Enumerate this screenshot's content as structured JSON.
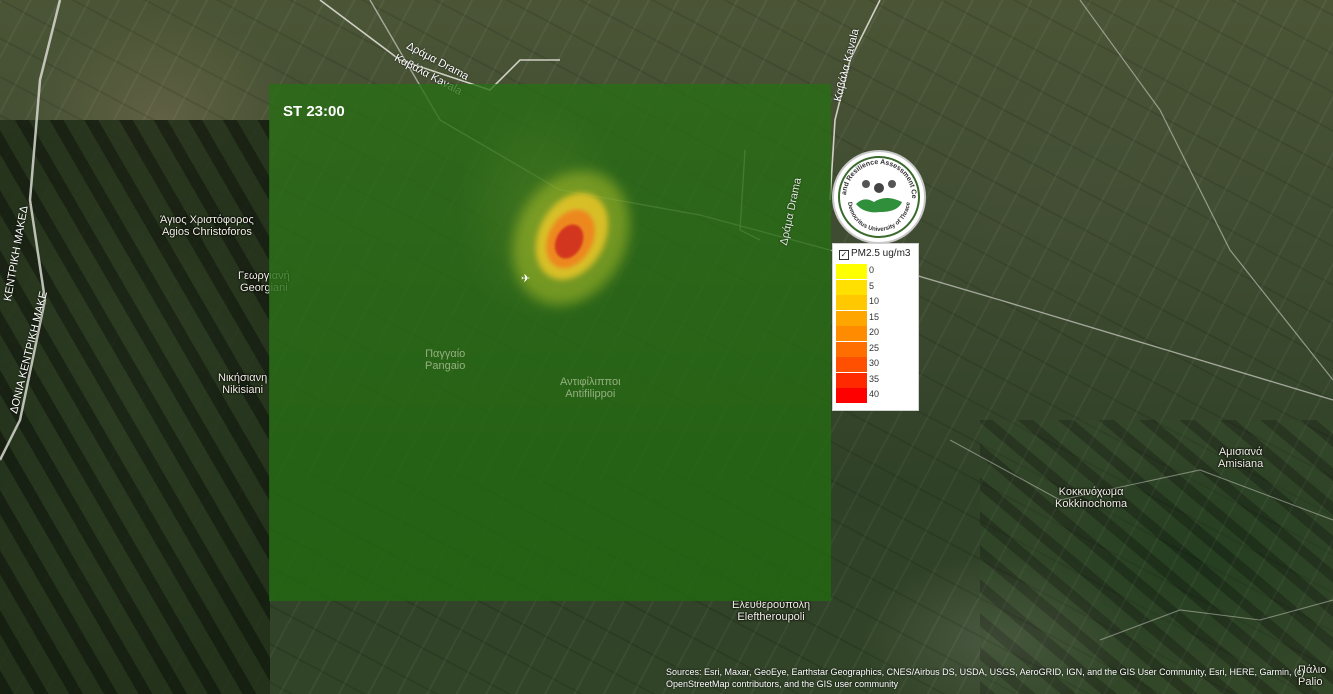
{
  "map": {
    "time_label": "ST 23:00",
    "layer": {
      "title": "PM2.5 ug/m3",
      "checked": true
    },
    "legend": {
      "items": [
        {
          "value": "0",
          "color": "#ffff00"
        },
        {
          "value": "5",
          "color": "#ffe000"
        },
        {
          "value": "10",
          "color": "#ffc800"
        },
        {
          "value": "15",
          "color": "#ffa500"
        },
        {
          "value": "20",
          "color": "#ff8c00"
        },
        {
          "value": "25",
          "color": "#ff6e00"
        },
        {
          "value": "30",
          "color": "#ff4f00"
        },
        {
          "value": "35",
          "color": "#ff2a00"
        },
        {
          "value": "40",
          "color": "#ff0000"
        }
      ]
    },
    "logo": {
      "text_top": "Risk and Resilience Assessment Centre",
      "text_bottom": "Democritus University of Thrace"
    },
    "places": [
      {
        "id": "agios-christoforos",
        "greek": "Άγιος Χριστόφορος",
        "latin": "Agios Christoforos"
      },
      {
        "id": "georgiani",
        "greek": "Γεωργιανή",
        "latin": "Georgiani"
      },
      {
        "id": "nikisiani",
        "greek": "Νικήσιανη",
        "latin": "Nikisiani"
      },
      {
        "id": "pangaio",
        "greek": "Παγγαίο",
        "latin": "Pangaio"
      },
      {
        "id": "antifilippoi",
        "greek": "Αντιφίλιπποι",
        "latin": "Antifilippoi"
      },
      {
        "id": "eleftheroupoli",
        "greek": "Ελευθερούπολη",
        "latin": "Eleftheroupoli"
      },
      {
        "id": "kokkinochoma",
        "greek": "Κοκκινόχωμα",
        "latin": "Kokkinochoma"
      },
      {
        "id": "amisiana",
        "greek": "Αμισιανά",
        "latin": "Amisiana"
      },
      {
        "id": "palio",
        "greek": "Πάλιο",
        "latin": "Palio"
      }
    ],
    "roads": [
      {
        "id": "drama-kavala-1a",
        "text": "Δράμα Drama"
      },
      {
        "id": "drama-kavala-1b",
        "text": "Καβάλα Kavala"
      },
      {
        "id": "kavala-2",
        "text": "Καβάλα Kavala"
      },
      {
        "id": "drama-2",
        "text": "Δράμα Drama"
      },
      {
        "id": "kentriki-1",
        "text": "ΚΕΝΤΡΙΚΗ ΜΑΚΕΔ"
      },
      {
        "id": "kentriki-2",
        "text": "ΔΟΝΙΑ ΚΕΝΤΡΙΚΗ ΜΑΚΕ"
      }
    ],
    "attribution": "Sources: Esri, Maxar, GeoEye, Earthstar Geographics, CNES/Airbus DS, USDA, USGS, AeroGRID, IGN, and the GIS User Community, Esri, HERE, Garmin, (c) OpenStreetMap contributors, and the GIS user community"
  }
}
